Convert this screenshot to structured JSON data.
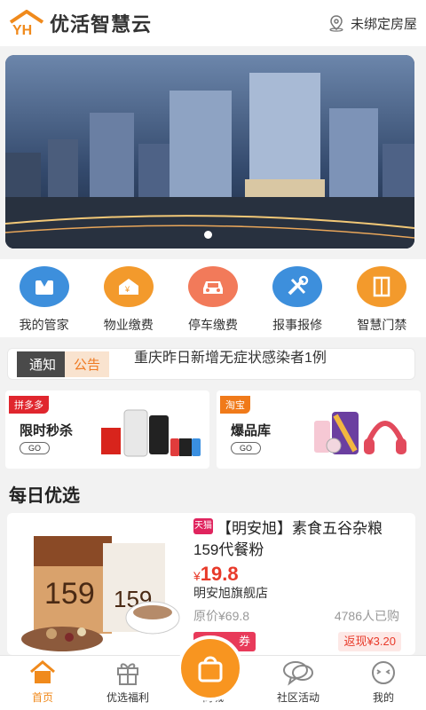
{
  "header": {
    "app_title": "优活智慧云",
    "house_link": "未绑定房屋"
  },
  "quick_menu": [
    {
      "label": "我的管家",
      "icon": "butler-icon",
      "color": "#3d8fdc"
    },
    {
      "label": "物业缴费",
      "icon": "property-fee-icon",
      "color": "#f39a2c"
    },
    {
      "label": "停车缴费",
      "icon": "car-icon",
      "color": "#f27a5a"
    },
    {
      "label": "报事报修",
      "icon": "repair-tools-icon",
      "color": "#3d8fdc"
    },
    {
      "label": "智慧门禁",
      "icon": "door-icon",
      "color": "#f39a2c"
    }
  ],
  "notice": {
    "tag1": "通知",
    "tag2": "公告",
    "text": "重庆昨日新增无症状感染者1例"
  },
  "promos": [
    {
      "tag": "拼多多",
      "title": "限时秒杀",
      "go": "GO",
      "tag_color": "#e0262e"
    },
    {
      "tag": "淘宝",
      "title": "爆品库",
      "go": "GO",
      "tag_color": "#f07a1a"
    }
  ],
  "section_title": "每日优选",
  "product": {
    "store_badge": "天猫",
    "name": "【明安旭】素食五谷杂粮159代餐粉",
    "price_currency": "¥",
    "price": "19.8",
    "shop": "明安旭旗舰店",
    "original_price": "原价¥69.8",
    "sold": "4786人已购",
    "coupon": "券",
    "rebate": "返现¥3.20"
  },
  "tabbar": [
    {
      "label": "首页",
      "icon": "home-icon",
      "active": true
    },
    {
      "label": "优选福利",
      "icon": "gift-icon",
      "active": false
    },
    {
      "label": "商城",
      "icon": "shopping-bag-icon",
      "active": false
    },
    {
      "label": "社区活动",
      "icon": "chat-bubbles-icon",
      "active": false
    },
    {
      "label": "我的",
      "icon": "face-icon",
      "active": false
    }
  ],
  "colors": {
    "accent": "#f08a1c",
    "price": "#e83a2a"
  }
}
